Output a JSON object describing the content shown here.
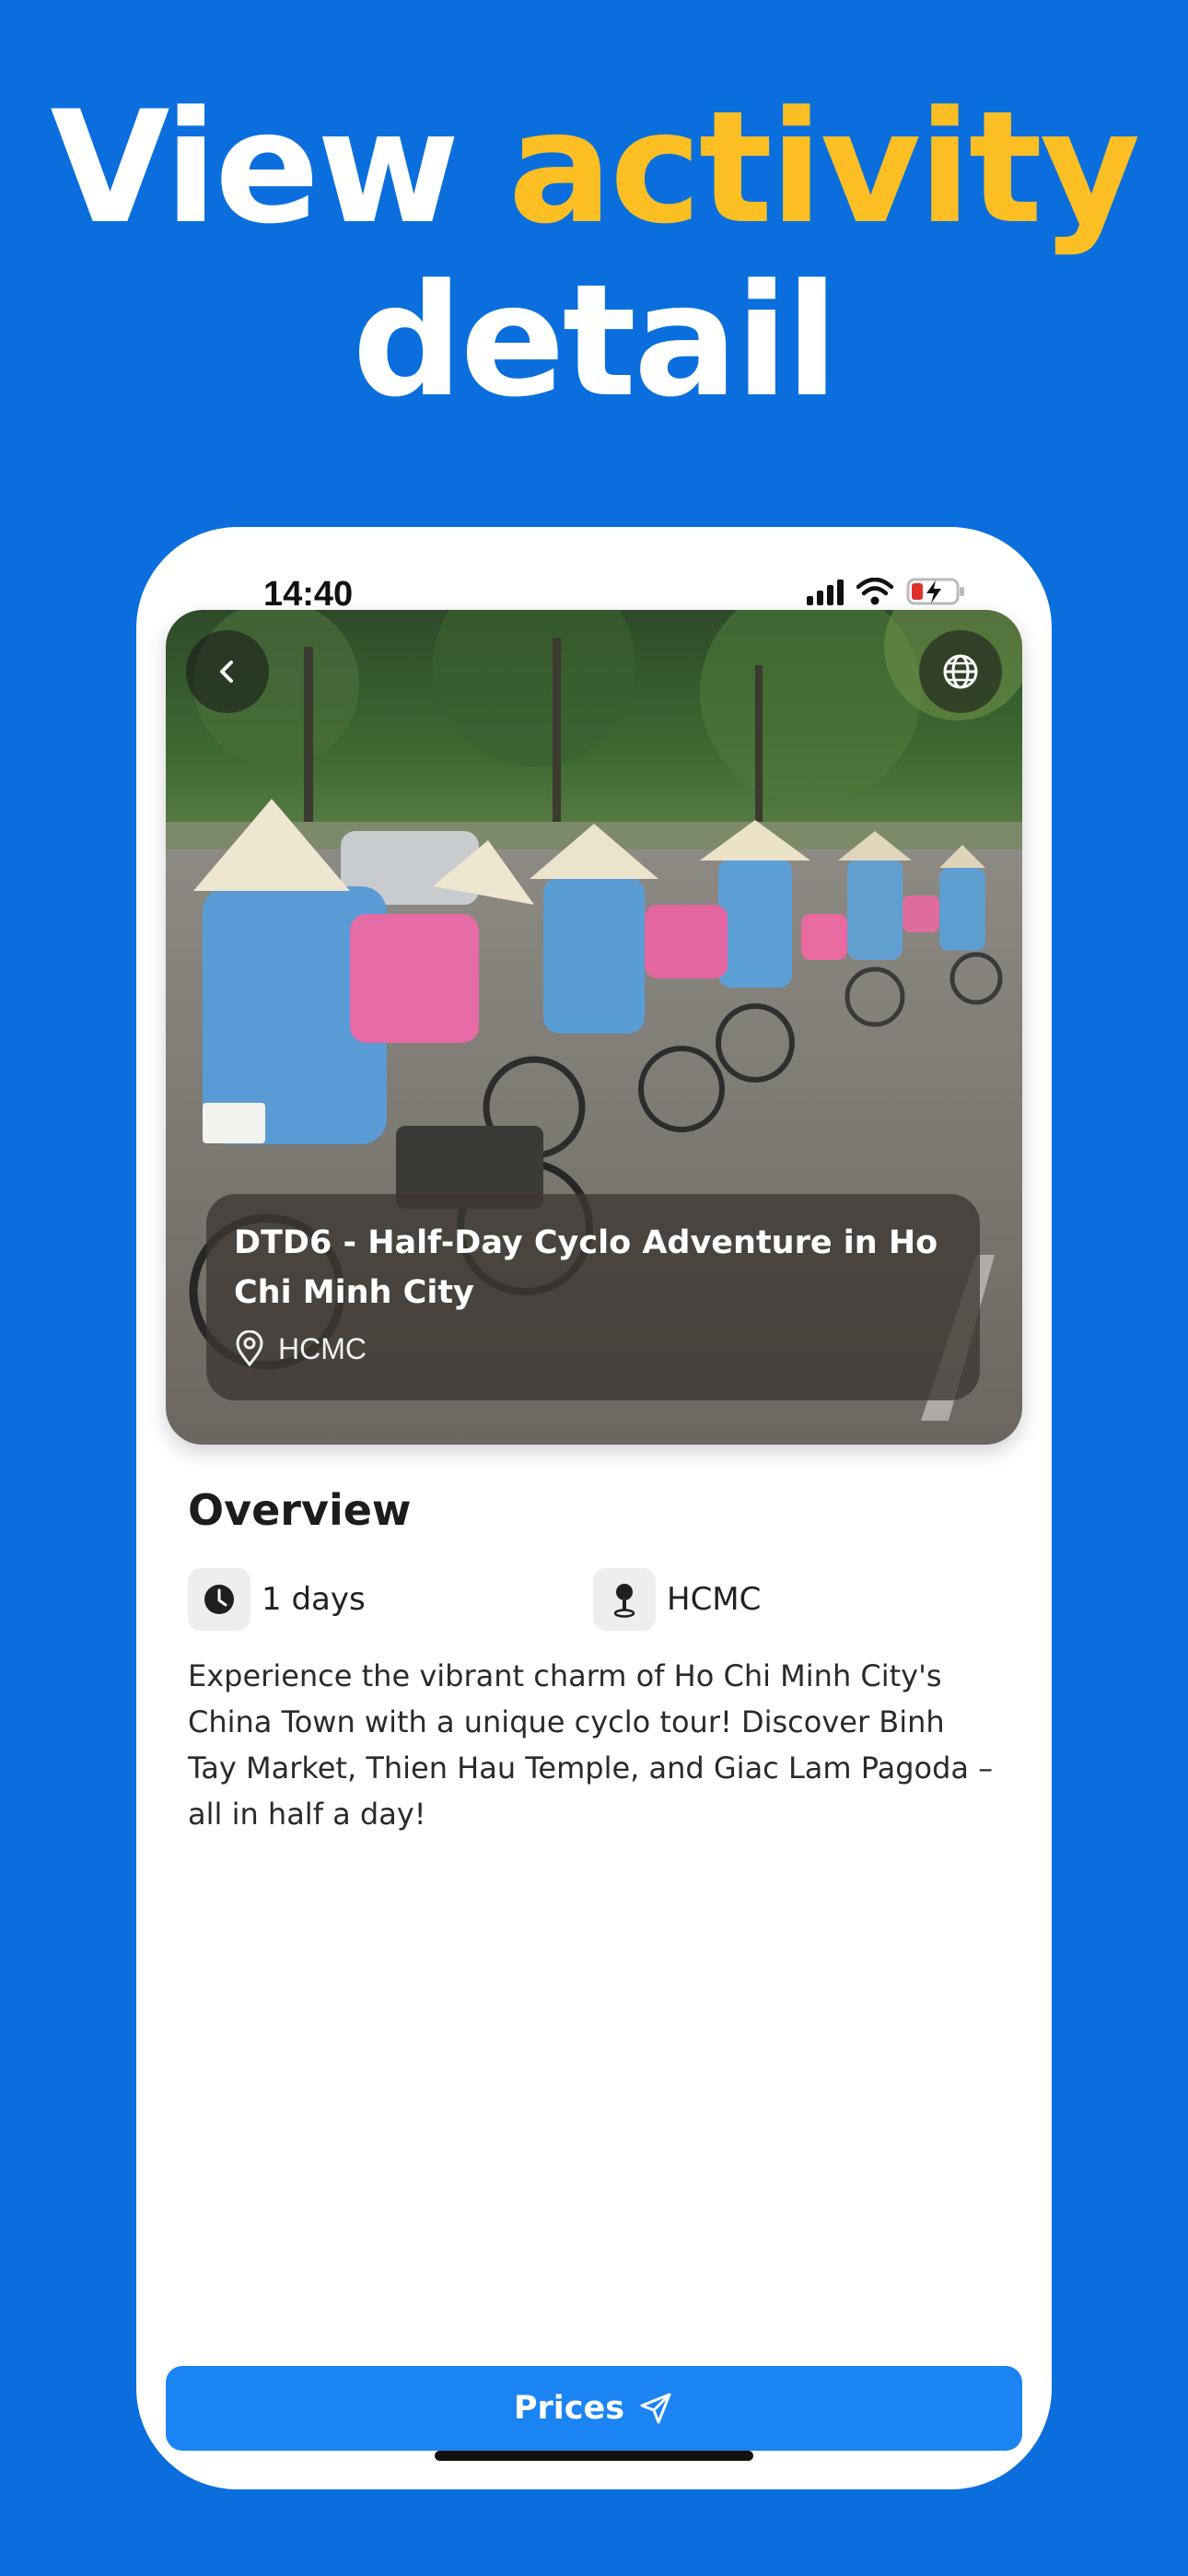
{
  "headline": {
    "line1_plain": "View ",
    "line1_accent": "activity",
    "line2": "detail",
    "accent_color": "#fbbf24"
  },
  "status_bar": {
    "time": "14:40",
    "icons": [
      "signal-icon",
      "wifi-icon",
      "battery-charging-icon"
    ]
  },
  "hero": {
    "back_icon": "chevron-left-icon",
    "language_icon": "globe-icon",
    "title": "DTD6 - Half-Day Cyclo Adventure in Ho Chi Minh City",
    "location_icon": "location-pin-icon",
    "location": "HCMC"
  },
  "overview": {
    "title": "Overview",
    "duration_icon": "clock-icon",
    "duration": "1 days",
    "place_icon": "map-pin-icon",
    "place": "HCMC",
    "description": "Experience the vibrant charm of Ho Chi Minh City's China Town with a unique cyclo tour! Discover Binh Tay Market, Thien Hau Temple, and Giac Lam Pagoda – all in half a day!"
  },
  "footer": {
    "prices_label": "Prices",
    "prices_icon": "send-icon",
    "button_color": "#1a84f2"
  },
  "colors": {
    "background": "#0a6fdc",
    "phone": "#ffffff"
  }
}
